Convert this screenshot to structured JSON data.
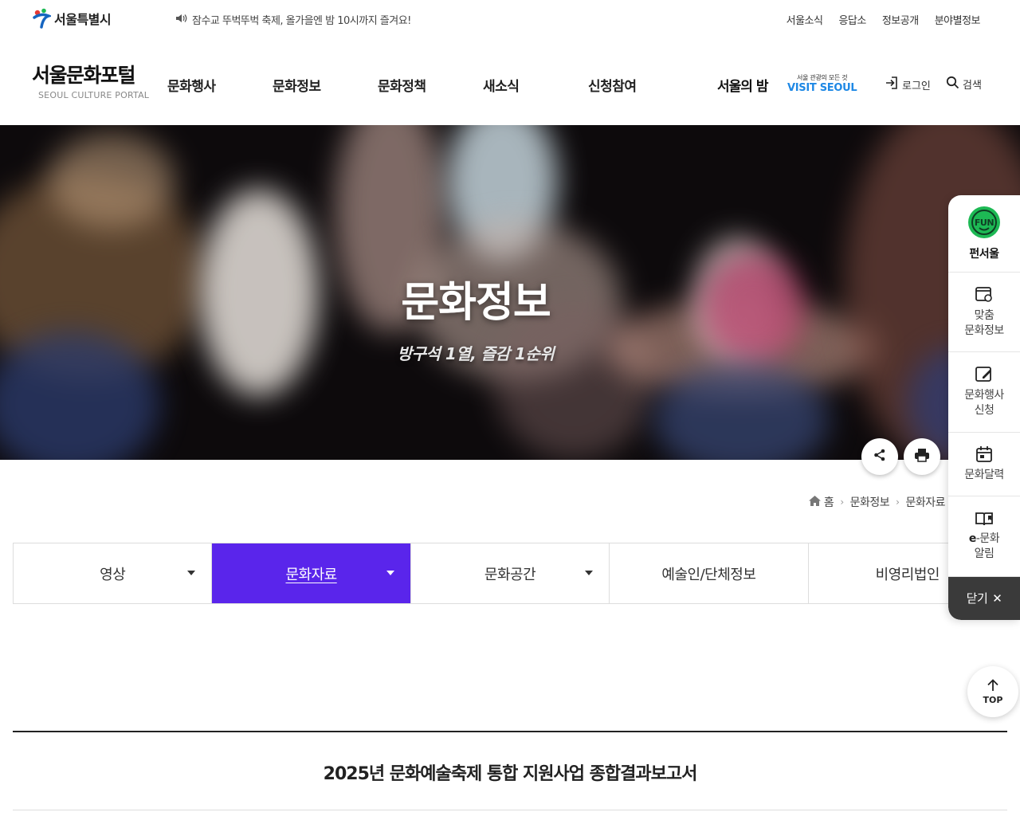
{
  "topbar": {
    "seoul_logo": "서울특별시",
    "notice": "잠수교 뚜벅뚜벅 축제, 올가을엔 밤 10시까지 즐겨요!",
    "util_links": [
      "서울소식",
      "응답소",
      "정보공개",
      "분야별정보"
    ]
  },
  "header": {
    "portal_name": "서울문화포털",
    "portal_name_en": "SEOUL CULTURE PORTAL",
    "gnb": [
      "문화행사",
      "문화정보",
      "문화정책",
      "새소식",
      "신청참여"
    ],
    "night_label": "서울의 밤",
    "visit_small": "서울 관광의 모든 것",
    "visit_big": "VISIT SEOUL",
    "login": "로그인",
    "search": "검색"
  },
  "hero": {
    "title": "문화정보",
    "subtitle": "방구석 1열, 즐감 1순위"
  },
  "breadcrumb": [
    "홈",
    "문화정보",
    "문화자료"
  ],
  "tabs": [
    {
      "label": "영상",
      "dropdown": true,
      "active": false
    },
    {
      "label": "문화자료",
      "dropdown": true,
      "active": true
    },
    {
      "label": "문화공간",
      "dropdown": true,
      "active": false
    },
    {
      "label": "예술인/단체정보",
      "dropdown": false,
      "active": false
    },
    {
      "label": "비영리법인",
      "dropdown": false,
      "active": false
    }
  ],
  "document": {
    "title": "2025년 문화예술축제 통합 지원사업 종합결과보고서"
  },
  "quick_menu": {
    "fun_label": "펀서울",
    "fun_badge": "FUN",
    "items": [
      {
        "line1": "맞춤",
        "line2": "문화정보"
      },
      {
        "line1": "문화행사",
        "line2": "신청"
      },
      {
        "line1": "문화달력",
        "line2": ""
      },
      {
        "line1": "e-문화",
        "line2": "알림"
      }
    ],
    "close": "닫기"
  },
  "top_button": "TOP",
  "colors": {
    "accent": "#5a25eb",
    "quick_close_bg": "#3a3a3a",
    "visit_blue": "#1e88e5",
    "fun_green": "#1db954"
  }
}
